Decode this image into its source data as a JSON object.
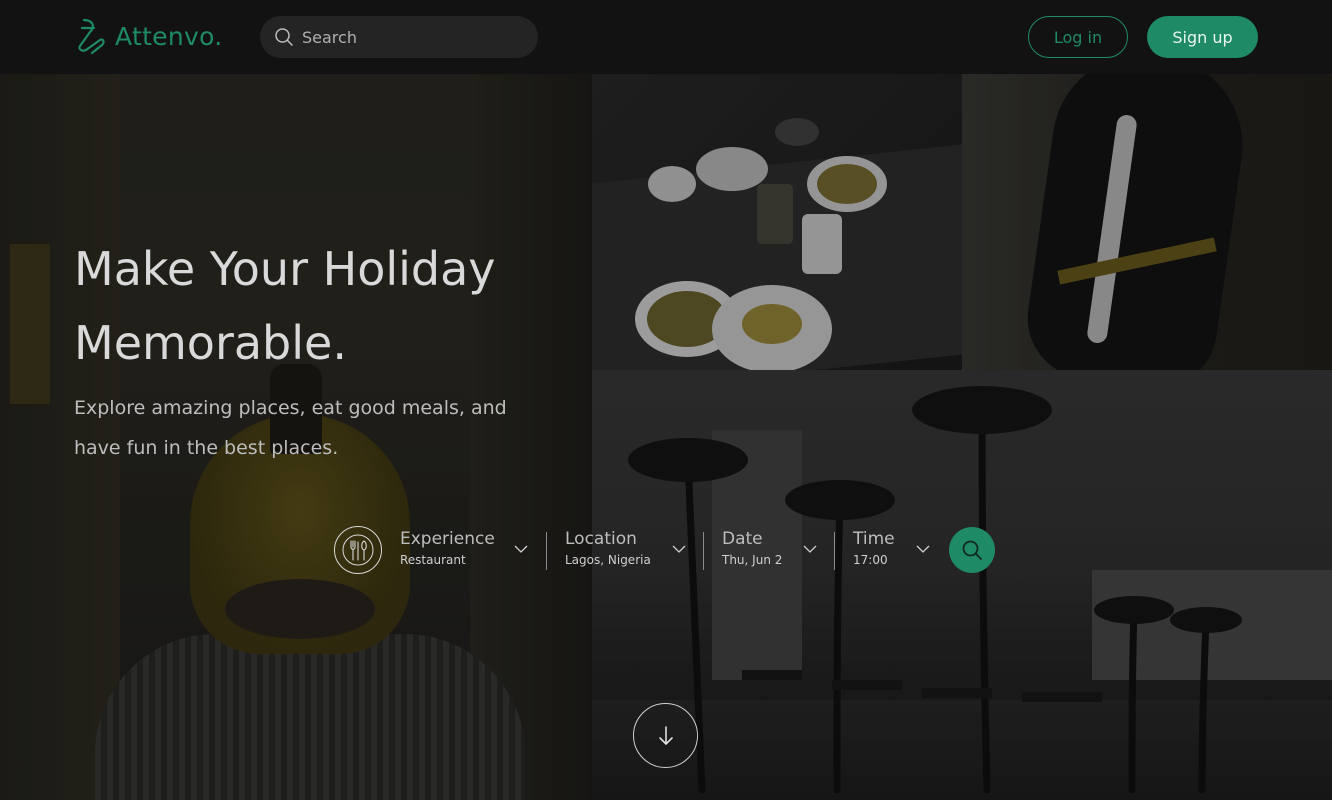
{
  "header": {
    "brand": "Attenvo.",
    "search": {
      "placeholder": "Search"
    },
    "login_label": "Log in",
    "signup_label": "Sign up"
  },
  "hero": {
    "title_line1": "Make Your Holiday",
    "title_line2": "Memorable.",
    "subtitle_line1": "Explore amazing places, eat good meals, and",
    "subtitle_line2": "have fun in the best places."
  },
  "booking": {
    "experience": {
      "label": "Experience",
      "value": "Restaurant",
      "icon": "restaurant-icon"
    },
    "location": {
      "label": "Location",
      "value": "Lagos, Nigeria"
    },
    "date": {
      "label": "Date",
      "value": "Thu, Jun 2"
    },
    "time": {
      "label": "Time",
      "value": "17:00"
    },
    "search_icon": "search-icon"
  },
  "scroll": {
    "icon": "arrow-down-icon"
  },
  "colors": {
    "accent": "#1f8a66",
    "header_bg": "#121212",
    "page_bg": "#1a1a1a"
  }
}
